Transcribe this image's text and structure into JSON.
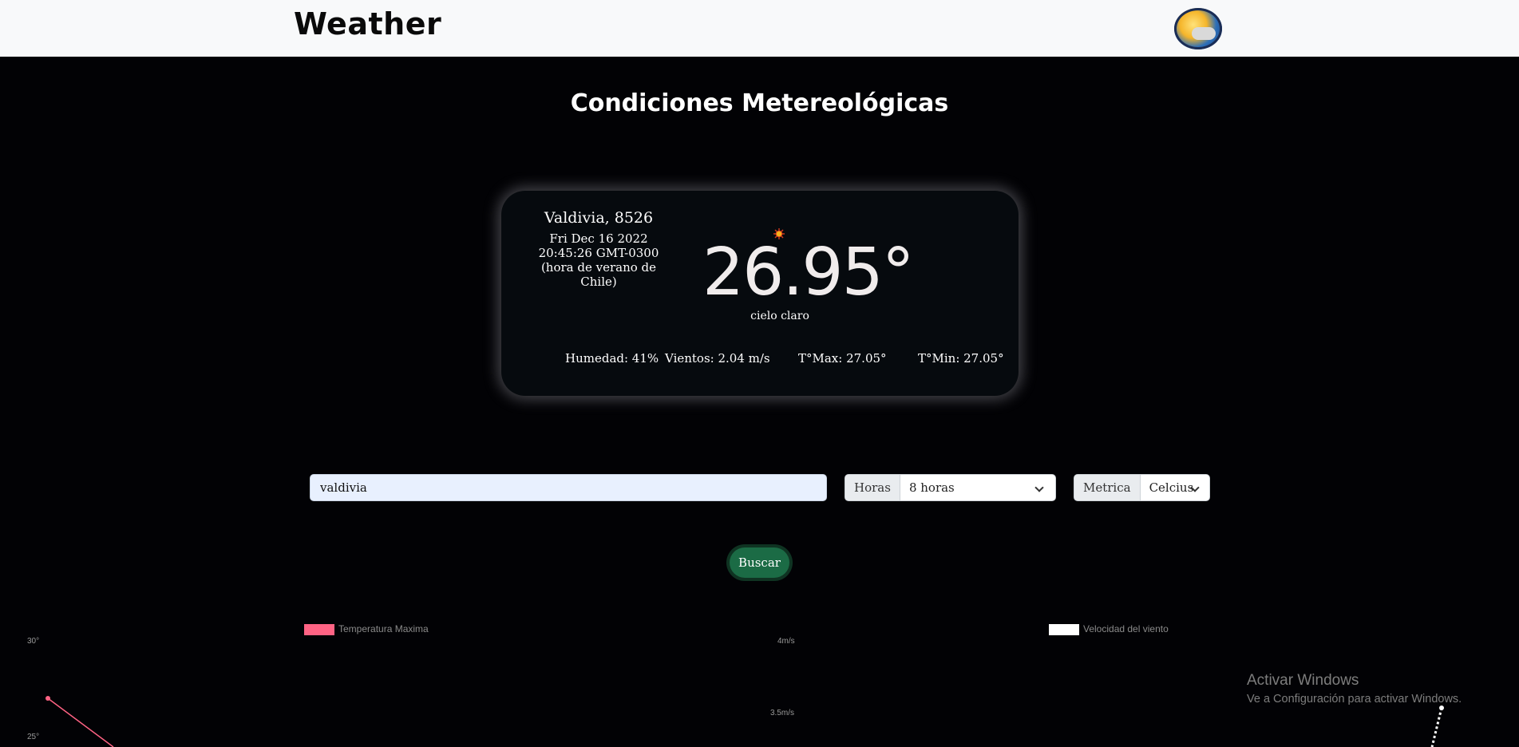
{
  "header": {
    "brand": "Weather",
    "logo_icon": "weather-logo-icon"
  },
  "page": {
    "title": "Condiciones Metereológicas"
  },
  "card": {
    "city": "Valdivia, 8526",
    "datetime": "Fri Dec 16 2022 20:45:26 GMT-0300 (hora de verano de Chile)",
    "weather_icon": "sun-icon",
    "temperature": "26.95°",
    "description": "cielo claro",
    "humidity": "Humedad: 41%",
    "wind": "Vientos: 2.04 m/s",
    "tmax": "T°Max: 27.05°",
    "tmin": "T°Min: 27.05°"
  },
  "form": {
    "search_value": "valdivia",
    "hours_label": "Horas",
    "hours_selected": "8 horas",
    "metric_label": "Metrica",
    "metric_selected": "Celcius",
    "search_button": "Buscar"
  },
  "charts": {
    "temp": {
      "legend": "Temperatura Maxima",
      "color": "#ff6384",
      "ticks": [
        "30°",
        "25°"
      ]
    },
    "wind": {
      "legend": "Velocidad del viento",
      "color": "#ffffff",
      "ticks": [
        "4m/s",
        "3.5m/s"
      ]
    }
  },
  "watermark": {
    "title": "Activar Windows",
    "subtitle": "Ve a Configuración para activar Windows."
  }
}
